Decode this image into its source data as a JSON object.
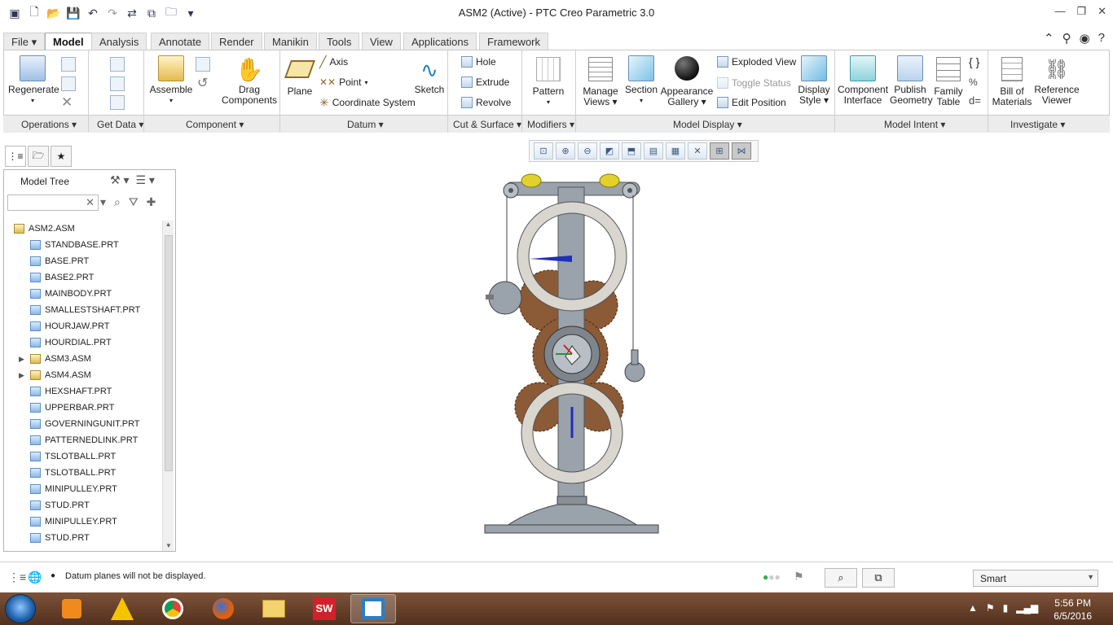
{
  "window": {
    "title": "ASM2 (Active) - PTC Creo Parametric 3.0"
  },
  "tabs": [
    "File",
    "Model",
    "Analysis",
    "Annotate",
    "Render",
    "Manikin",
    "Tools",
    "View",
    "Applications",
    "Framework"
  ],
  "ribbon": {
    "regenerate": "Regenerate",
    "assemble": "Assemble",
    "drag_components": [
      "Drag",
      "Components"
    ],
    "plane": "Plane",
    "axis": "Axis",
    "point": "Point",
    "coordinate_system": "Coordinate System",
    "sketch": "Sketch",
    "hole": "Hole",
    "extrude": "Extrude",
    "revolve": "Revolve",
    "pattern": "Pattern",
    "manage_views": [
      "Manage",
      "Views"
    ],
    "section": "Section",
    "appearance_gallery": [
      "Appearance",
      "Gallery"
    ],
    "exploded_view": "Exploded View",
    "toggle_status": "Toggle Status",
    "edit_position": "Edit Position",
    "display_style": [
      "Display",
      "Style"
    ],
    "component_interface": [
      "Component",
      "Interface"
    ],
    "publish_geometry": [
      "Publish",
      "Geometry"
    ],
    "family_table": [
      "Family",
      "Table"
    ],
    "bill_of_materials": [
      "Bill of",
      "Materials"
    ],
    "reference_viewer": [
      "Reference",
      "Viewer"
    ]
  },
  "groups": [
    "Operations",
    "Get Data",
    "Component",
    "Datum",
    "Cut & Surface",
    "Modifiers",
    "Model Display",
    "Model Intent",
    "Investigate"
  ],
  "model_tree": {
    "title": "Model Tree",
    "items": [
      {
        "label": "ASM2.ASM",
        "type": "asm",
        "level": 0
      },
      {
        "label": "STANDBASE.PRT",
        "type": "prt",
        "level": 1
      },
      {
        "label": "BASE.PRT",
        "type": "prt",
        "level": 1
      },
      {
        "label": "BASE2.PRT",
        "type": "prt",
        "level": 1
      },
      {
        "label": "MAINBODY.PRT",
        "type": "prt",
        "level": 1
      },
      {
        "label": "SMALLESTSHAFT.PRT",
        "type": "prt",
        "level": 1
      },
      {
        "label": "HOURJAW.PRT",
        "type": "prt",
        "level": 1
      },
      {
        "label": "HOURDIAL.PRT",
        "type": "prt",
        "level": 1
      },
      {
        "label": "ASM3.ASM",
        "type": "asm",
        "level": 1,
        "expandable": true
      },
      {
        "label": "ASM4.ASM",
        "type": "asm",
        "level": 1,
        "expandable": true
      },
      {
        "label": "HEXSHAFT.PRT",
        "type": "prt",
        "level": 1
      },
      {
        "label": "UPPERBAR.PRT",
        "type": "prt",
        "level": 1
      },
      {
        "label": "GOVERNINGUNIT.PRT",
        "type": "prt",
        "level": 1
      },
      {
        "label": "PATTERNEDLINK.PRT",
        "type": "prt",
        "level": 1
      },
      {
        "label": "TSLOTBALL.PRT",
        "type": "prt",
        "level": 1
      },
      {
        "label": "TSLOTBALL.PRT",
        "type": "prt",
        "level": 1
      },
      {
        "label": "MINIPULLEY.PRT",
        "type": "prt",
        "level": 1
      },
      {
        "label": "STUD.PRT",
        "type": "prt",
        "level": 1
      },
      {
        "label": "MINIPULLEY.PRT",
        "type": "prt",
        "level": 1
      },
      {
        "label": "STUD.PRT",
        "type": "prt",
        "level": 1
      }
    ]
  },
  "status": {
    "message": "Datum planes will not be displayed.",
    "filter": "Smart"
  },
  "clock": {
    "time": "5:56 PM",
    "date": "6/5/2016"
  },
  "colors": {
    "accent": "#3b73b9",
    "gear": "#8b5a36",
    "dial": "#d9d6cf",
    "body": "#9aa2ab",
    "hand": "#1f2fb8"
  }
}
